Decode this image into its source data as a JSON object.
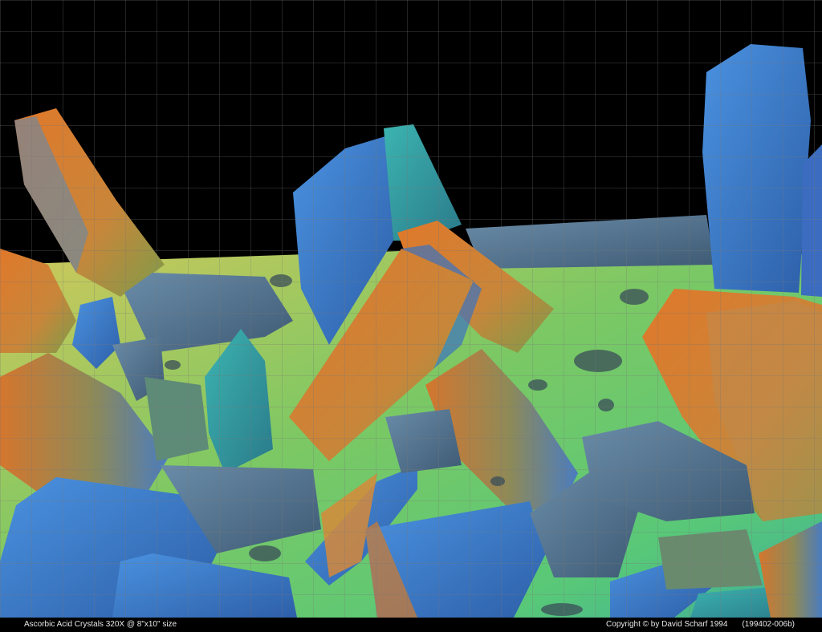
{
  "caption": {
    "left": "Ascorbic Acid Crystals  320X @ 8\"x10\" size",
    "copyright": "Copyright © by David Scharf 1994",
    "catalog_id": "(199402-006b)"
  },
  "colors": {
    "background": "#000000",
    "floor_green": "#6fc86a",
    "floor_yellow": "#c8d25a",
    "crystal_blue": "#3f7fd0",
    "crystal_orange": "#d07a2c",
    "crystal_steel": "#5a7b98",
    "crystal_teal": "#3aa8a8"
  }
}
